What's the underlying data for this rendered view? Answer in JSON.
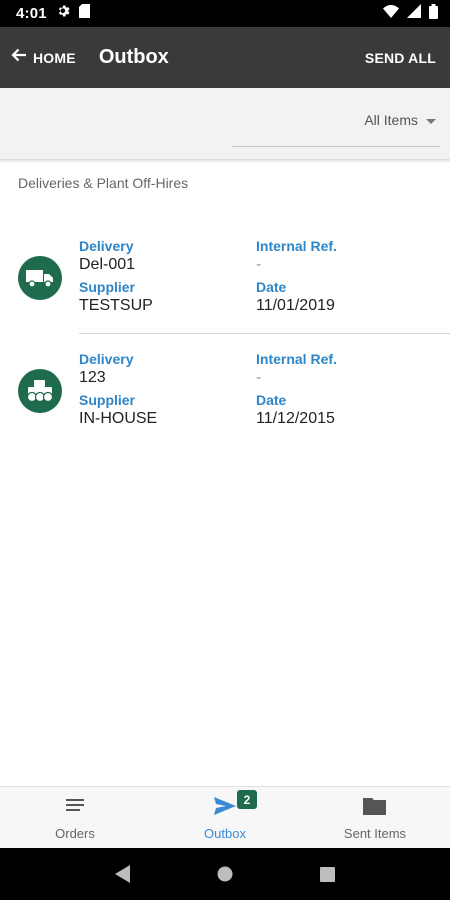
{
  "status_bar": {
    "time": "4:01"
  },
  "app_bar": {
    "back_label": "HOME",
    "title": "Outbox",
    "action_label": "SEND ALL"
  },
  "filter": {
    "selected": "All Items"
  },
  "section": {
    "title": "Deliveries & Plant Off-Hires"
  },
  "items": [
    {
      "icon": "truck-icon",
      "type_label": "Delivery",
      "type_value": "Del-001",
      "ref_label": "Internal Ref.",
      "ref_value": "-",
      "supplier_label": "Supplier",
      "supplier_value": "TESTSUP",
      "date_label": "Date",
      "date_value": "11/01/2019"
    },
    {
      "icon": "plant-vehicle-icon",
      "type_label": "Delivery",
      "type_value": "123",
      "ref_label": "Internal Ref.",
      "ref_value": "-",
      "supplier_label": "Supplier",
      "supplier_value": "IN-HOUSE",
      "date_label": "Date",
      "date_value": "11/12/2015"
    }
  ],
  "bottom_nav": {
    "items": [
      {
        "label": "Orders",
        "icon": "list-icon"
      },
      {
        "label": "Outbox",
        "icon": "send-icon",
        "badge": "2"
      },
      {
        "label": "Sent Items",
        "icon": "folder-icon"
      }
    ],
    "active": "Outbox"
  },
  "colors": {
    "app_bar": "#3a3a3c",
    "accent_green": "#1f6b4e",
    "label_blue": "#2e86c8",
    "active_nav": "#3a8ad6"
  }
}
